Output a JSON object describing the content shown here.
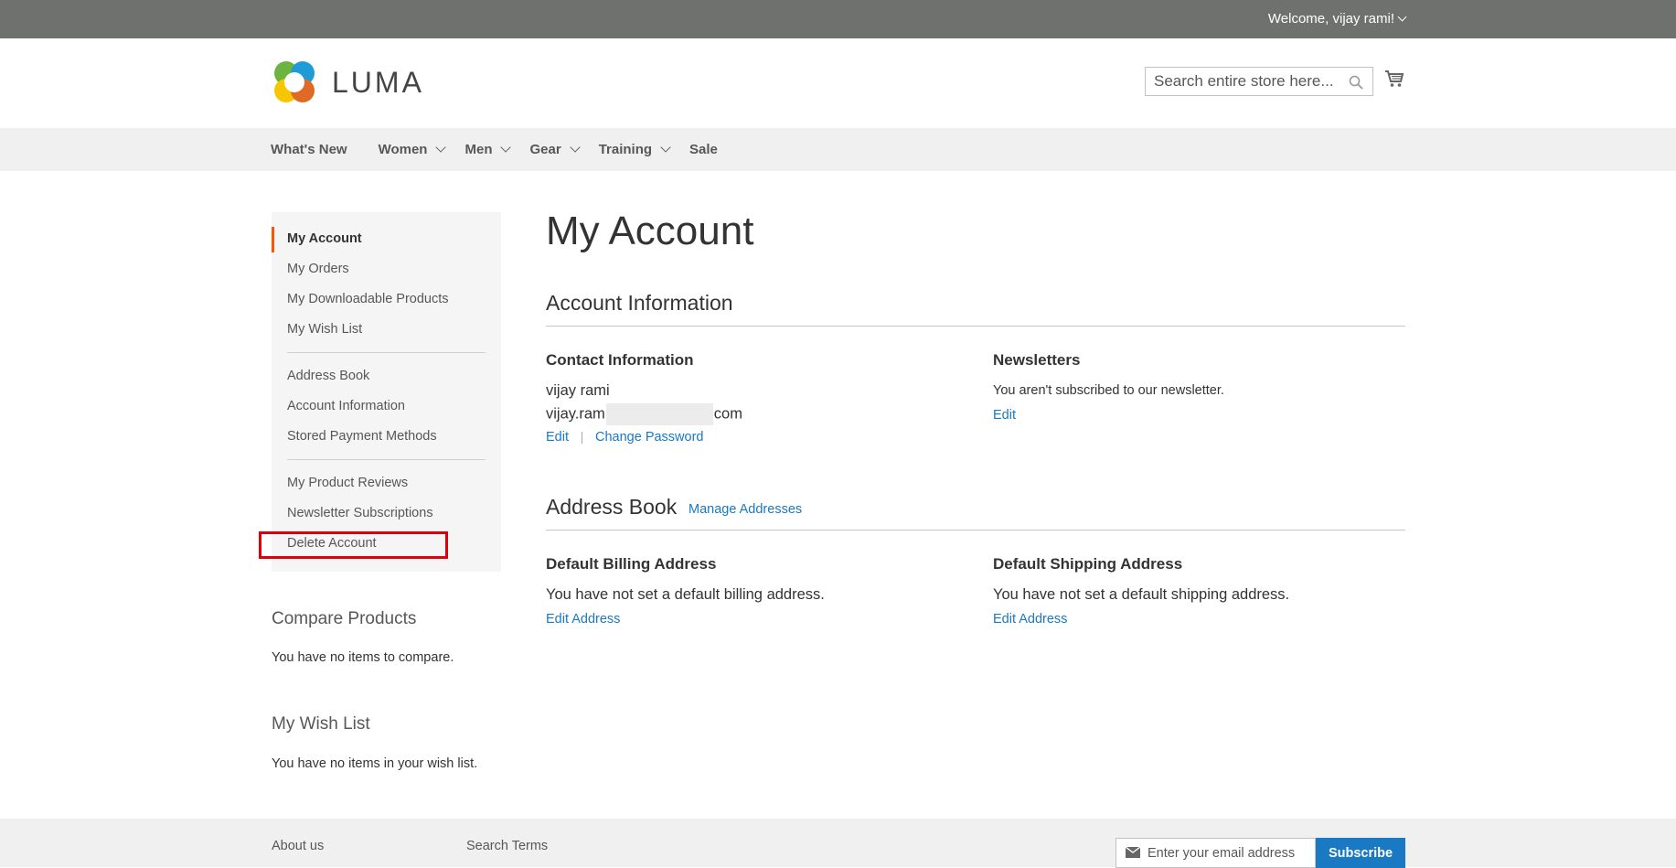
{
  "topbar": {
    "welcome": "Welcome, vijay rami!"
  },
  "header": {
    "logo_text": "LUMA",
    "search_placeholder": "Search entire store here..."
  },
  "nav": {
    "items": [
      {
        "label": "What's New"
      },
      {
        "label": "Women"
      },
      {
        "label": "Men"
      },
      {
        "label": "Gear"
      },
      {
        "label": "Training"
      },
      {
        "label": "Sale"
      }
    ]
  },
  "sidebar": {
    "items": [
      {
        "label": "My Account"
      },
      {
        "label": "My Orders"
      },
      {
        "label": "My Downloadable Products"
      },
      {
        "label": "My Wish List"
      },
      {
        "label": "Address Book"
      },
      {
        "label": "Account Information"
      },
      {
        "label": "Stored Payment Methods"
      },
      {
        "label": "My Product Reviews"
      },
      {
        "label": "Newsletter Subscriptions"
      },
      {
        "label": "Delete Account"
      }
    ],
    "accent_color": "#ff5501"
  },
  "compare": {
    "title": "Compare Products",
    "text": "You have no items to compare."
  },
  "wishlist": {
    "title": "My Wish List",
    "text": "You have no items in your wish list."
  },
  "main": {
    "page_title": "My Account",
    "account_info": {
      "title": "Account Information",
      "contact": {
        "title": "Contact Information",
        "name": "vijay rami",
        "email_start": "vijay.ram",
        "email_end": "com",
        "edit": "Edit",
        "change_password": "Change Password"
      },
      "newsletters": {
        "title": "Newsletters",
        "text": "You aren't subscribed to our newsletter.",
        "edit": "Edit"
      }
    },
    "address_book": {
      "title": "Address Book",
      "manage": "Manage Addresses",
      "billing": {
        "title": "Default Billing Address",
        "text": "You have not set a default billing address.",
        "edit": "Edit Address"
      },
      "shipping": {
        "title": "Default Shipping Address",
        "text": "You have not set a default shipping address.",
        "edit": "Edit Address"
      }
    }
  },
  "footer": {
    "about": "About us",
    "search_terms": "Search Terms",
    "email_placeholder": "Enter your email address",
    "subscribe": "Subscribe"
  },
  "colors": {
    "link": "#1979c3",
    "topbar": "#6e716e",
    "highlight": "#e0000b"
  }
}
